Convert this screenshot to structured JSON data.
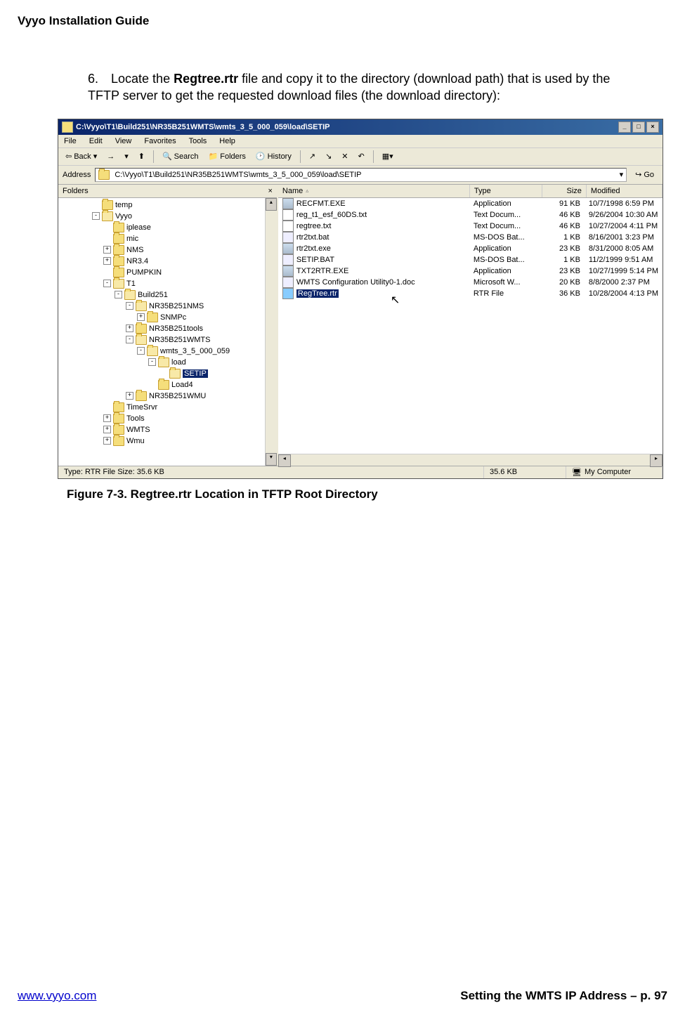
{
  "doc": {
    "header": "Vyyo Installation Guide",
    "step_num": "6.",
    "step_text_pre": "Locate the ",
    "step_bold": "Regtree.rtr",
    "step_text_post": " file and copy it to the directory (download path) that is used by the TFTP server to get the requested download files (the download directory):",
    "caption": "Figure 7-3. Regtree.rtr Location in TFTP Root Directory",
    "footer_url": "www.vyyo.com",
    "footer_right": "Setting the WMTS IP Address – p. 97"
  },
  "win": {
    "title": "C:\\Vyyo\\T1\\Build251\\NR35B251WMTS\\wmts_3_5_000_059\\load\\SETIP",
    "menu": [
      "File",
      "Edit",
      "View",
      "Favorites",
      "Tools",
      "Help"
    ],
    "back": "Back",
    "search": "Search",
    "folders": "Folders",
    "history": "History",
    "address_label": "Address",
    "address_value": "C:\\Vyyo\\T1\\Build251\\NR35B251WMTS\\wmts_3_5_000_059\\load\\SETIP",
    "go": "Go",
    "folders_header": "Folders",
    "close_x": "×",
    "columns": {
      "name": "Name",
      "type": "Type",
      "size": "Size",
      "mod": "Modified"
    },
    "status_left": "Type: RTR File Size: 35.6 KB",
    "status_size": "35.6 KB",
    "status_loc": "My Computer"
  },
  "tree": [
    {
      "indent": 3,
      "exp": "",
      "name": "temp"
    },
    {
      "indent": 3,
      "exp": "-",
      "name": "Vyyo",
      "open": true
    },
    {
      "indent": 4,
      "exp": "",
      "name": "iplease"
    },
    {
      "indent": 4,
      "exp": "",
      "name": "mic"
    },
    {
      "indent": 4,
      "exp": "+",
      "name": "NMS"
    },
    {
      "indent": 4,
      "exp": "+",
      "name": "NR3.4"
    },
    {
      "indent": 4,
      "exp": "",
      "name": "PUMPKIN"
    },
    {
      "indent": 4,
      "exp": "-",
      "name": "T1",
      "open": true
    },
    {
      "indent": 5,
      "exp": "-",
      "name": "Build251",
      "open": true
    },
    {
      "indent": 6,
      "exp": "-",
      "name": "NR35B251NMS",
      "open": true
    },
    {
      "indent": 7,
      "exp": "+",
      "name": "SNMPc"
    },
    {
      "indent": 6,
      "exp": "+",
      "name": "NR35B251tools"
    },
    {
      "indent": 6,
      "exp": "-",
      "name": "NR35B251WMTS",
      "open": true
    },
    {
      "indent": 7,
      "exp": "-",
      "name": "wmts_3_5_000_059",
      "open": true
    },
    {
      "indent": 8,
      "exp": "-",
      "name": "load",
      "open": true
    },
    {
      "indent": 9,
      "exp": "",
      "name": "SETIP",
      "open": true,
      "sel": true
    },
    {
      "indent": 8,
      "exp": "",
      "name": "Load4"
    },
    {
      "indent": 6,
      "exp": "+",
      "name": "NR35B251WMU"
    },
    {
      "indent": 4,
      "exp": "",
      "name": "TimeSrvr"
    },
    {
      "indent": 4,
      "exp": "+",
      "name": "Tools"
    },
    {
      "indent": 4,
      "exp": "+",
      "name": "WMTS"
    },
    {
      "indent": 4,
      "exp": "+",
      "name": "Wmu"
    }
  ],
  "files": [
    {
      "icon": "exe",
      "name": "RECFMT.EXE",
      "type": "Application",
      "size": "91 KB",
      "mod": "10/7/1998 6:59 PM"
    },
    {
      "icon": "txt",
      "name": "reg_t1_esf_60DS.txt",
      "type": "Text Docum...",
      "size": "46 KB",
      "mod": "9/26/2004 10:30 AM"
    },
    {
      "icon": "txt",
      "name": "regtree.txt",
      "type": "Text Docum...",
      "size": "46 KB",
      "mod": "10/27/2004 4:11 PM"
    },
    {
      "icon": "bat",
      "name": "rtr2txt.bat",
      "type": "MS-DOS Bat...",
      "size": "1 KB",
      "mod": "8/16/2001 3:23 PM"
    },
    {
      "icon": "exe",
      "name": "rtr2txt.exe",
      "type": "Application",
      "size": "23 KB",
      "mod": "8/31/2000 8:05 AM"
    },
    {
      "icon": "bat",
      "name": "SETIP.BAT",
      "type": "MS-DOS Bat...",
      "size": "1 KB",
      "mod": "11/2/1999 9:51 AM"
    },
    {
      "icon": "exe",
      "name": "TXT2RTR.EXE",
      "type": "Application",
      "size": "23 KB",
      "mod": "10/27/1999 5:14 PM"
    },
    {
      "icon": "doc",
      "name": "WMTS Configuration Utility0-1.doc",
      "type": "Microsoft W...",
      "size": "20 KB",
      "mod": "8/8/2000 2:37 PM"
    },
    {
      "icon": "rtr",
      "name": "RegTree.rtr",
      "type": "RTR File",
      "size": "36 KB",
      "mod": "10/28/2004 4:13 PM",
      "selected": true
    }
  ]
}
